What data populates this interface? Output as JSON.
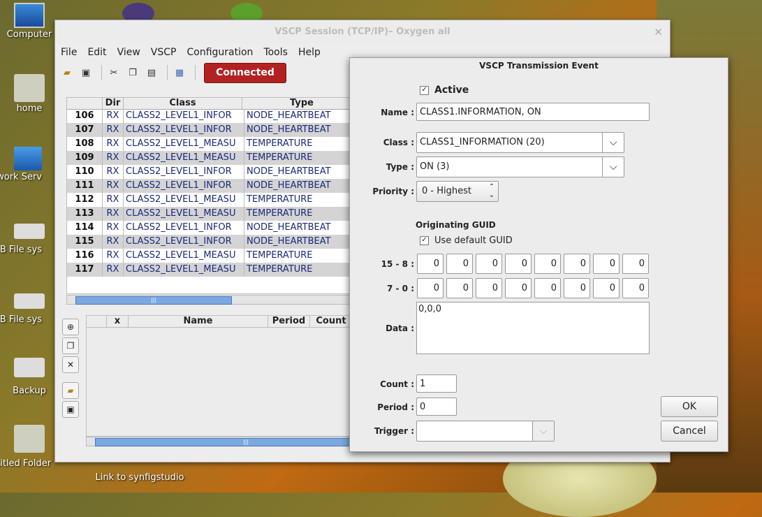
{
  "desktop": {
    "icons": [
      {
        "label": "Computer"
      },
      {
        "label": "home"
      },
      {
        "label": "etwork Serv"
      },
      {
        "label": "GB File sys"
      },
      {
        "label": "MB File sys"
      },
      {
        "label": "Backup"
      },
      {
        "label": "ntitled Folder"
      }
    ],
    "link_label": "Link to synfigstudio"
  },
  "mainwin": {
    "title": "VSCP Session (TCP/IP)– Oxygen all",
    "menu": [
      "File",
      "Edit",
      "View",
      "VSCP",
      "Configuration",
      "Tools",
      "Help"
    ],
    "connected_label": "Connected",
    "grid": {
      "columns": [
        "Dir",
        "Class",
        "Type"
      ],
      "rows": [
        {
          "num": "106",
          "dir": "RX",
          "cls": "CLASS2_LEVEL1_INFOR",
          "typ": "NODE_HEARTBEAT"
        },
        {
          "num": "107",
          "dir": "RX",
          "cls": "CLASS2_LEVEL1_INFOR",
          "typ": "NODE_HEARTBEAT"
        },
        {
          "num": "108",
          "dir": "RX",
          "cls": "CLASS2_LEVEL1_MEASU",
          "typ": "TEMPERATURE"
        },
        {
          "num": "109",
          "dir": "RX",
          "cls": "CLASS2_LEVEL1_MEASU",
          "typ": "TEMPERATURE"
        },
        {
          "num": "110",
          "dir": "RX",
          "cls": "CLASS2_LEVEL1_INFOR",
          "typ": "NODE_HEARTBEAT"
        },
        {
          "num": "111",
          "dir": "RX",
          "cls": "CLASS2_LEVEL1_INFOR",
          "typ": "NODE_HEARTBEAT"
        },
        {
          "num": "112",
          "dir": "RX",
          "cls": "CLASS2_LEVEL1_MEASU",
          "typ": "TEMPERATURE"
        },
        {
          "num": "113",
          "dir": "RX",
          "cls": "CLASS2_LEVEL1_MEASU",
          "typ": "TEMPERATURE"
        },
        {
          "num": "114",
          "dir": "RX",
          "cls": "CLASS2_LEVEL1_INFOR",
          "typ": "NODE_HEARTBEAT"
        },
        {
          "num": "115",
          "dir": "RX",
          "cls": "CLASS2_LEVEL1_INFOR",
          "typ": "NODE_HEARTBEAT"
        },
        {
          "num": "116",
          "dir": "RX",
          "cls": "CLASS2_LEVEL1_MEASU",
          "typ": "TEMPERATURE"
        },
        {
          "num": "117",
          "dir": "RX",
          "cls": "CLASS2_LEVEL1_MEASU",
          "typ": "TEMPERATURE"
        }
      ]
    },
    "tx_table": {
      "columns": [
        "x",
        "Name",
        "Period",
        "Count"
      ]
    }
  },
  "dialog": {
    "title": "VSCP Transmission Event",
    "active_label": "Active",
    "name_label": "Name :",
    "name_value": "CLASS1.INFORMATION, ON",
    "class_label": "Class :",
    "class_value": "CLASS1_INFORMATION (20)",
    "type_label": "Type :",
    "type_value": "ON (3)",
    "priority_label": "Priority :",
    "priority_value": "0 - Highest",
    "guid_section": "Originating GUID",
    "default_guid_label": "Use default GUID",
    "guid_hi_label": "15 - 8 :",
    "guid_lo_label": "7 - 0 :",
    "guid_hi": [
      "0",
      "0",
      "0",
      "0",
      "0",
      "0",
      "0",
      "0"
    ],
    "guid_lo": [
      "0",
      "0",
      "0",
      "0",
      "0",
      "0",
      "0",
      "0"
    ],
    "data_label": "Data :",
    "data_value": "0,0,0",
    "count_label": "Count :",
    "count_value": "1",
    "period_label": "Period :",
    "period_value": "0",
    "trigger_label": "Trigger :",
    "trigger_value": "",
    "ok_label": "OK",
    "cancel_label": "Cancel"
  }
}
